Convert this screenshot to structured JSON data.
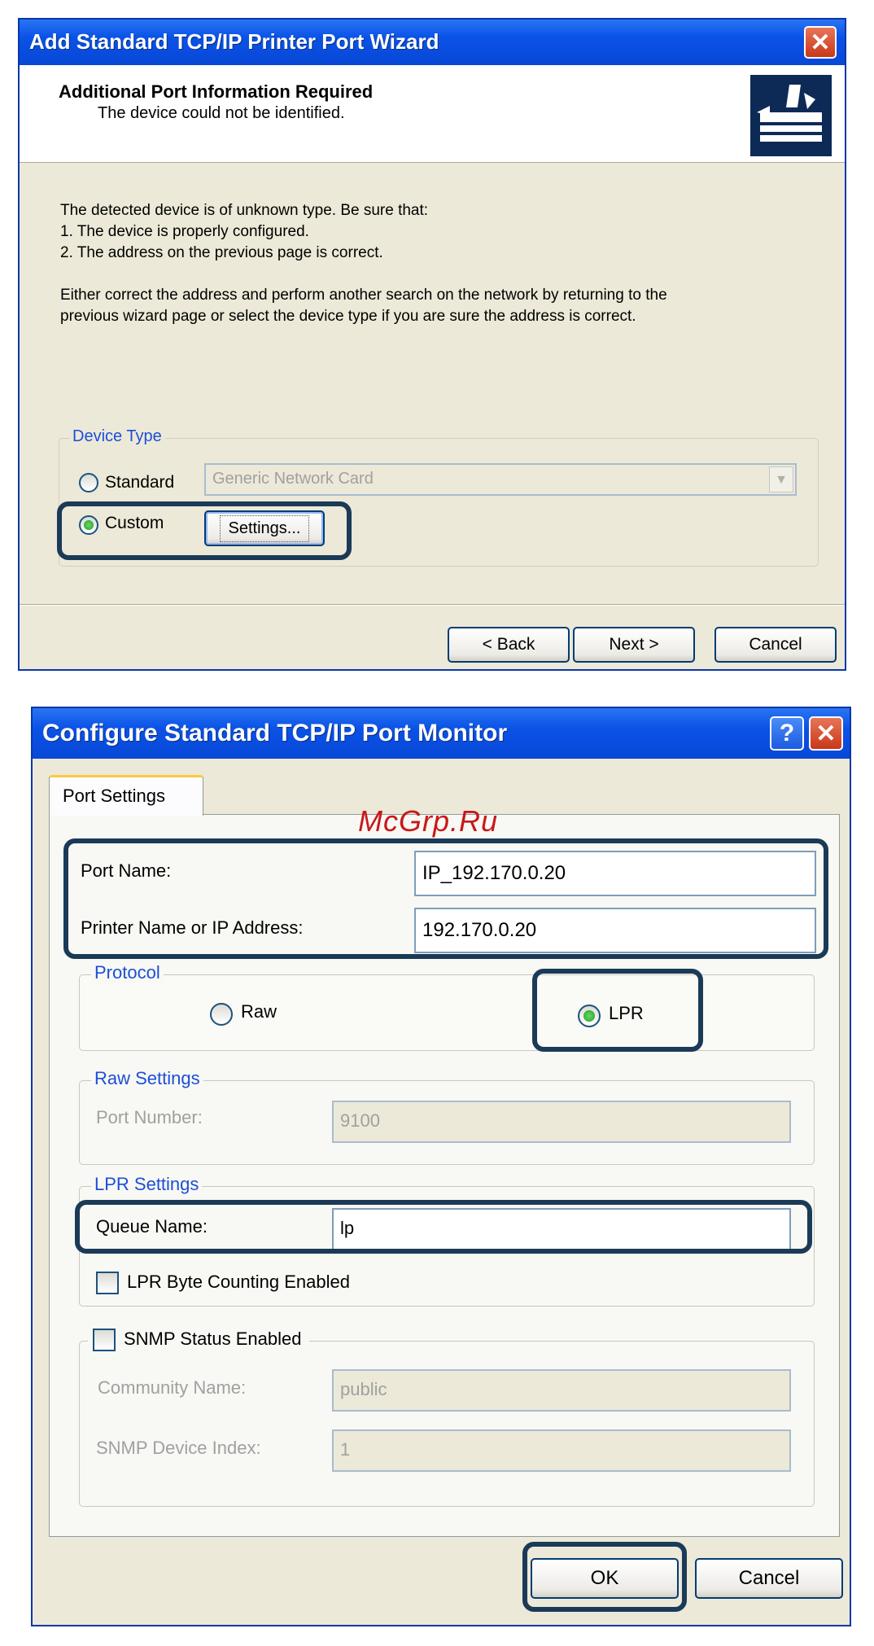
{
  "wizard": {
    "title": "Add Standard TCP/IP Printer Port Wizard",
    "close_icon": "close-icon",
    "header_title": "Additional Port Information Required",
    "header_subtitle": "The device could not be identified.",
    "header_icon": "printer-network-icon",
    "body_line1": "The detected device is of unknown type.  Be sure that:",
    "body_line2": "1. The device is properly configured.",
    "body_line3": "2.  The address on the previous page is correct.",
    "body_para_line1": "Either correct the address and perform another search on the network by returning to the",
    "body_para_line2": "previous wizard page or select the device type if you are sure the address is correct.",
    "device_type_legend": "Device Type",
    "standard_label": "Standard",
    "standard_selected": false,
    "standard_dropdown_value": "Generic Network Card",
    "custom_label": "Custom",
    "custom_selected": true,
    "settings_button": "Settings...",
    "back_button": "< Back",
    "next_button": "Next >",
    "cancel_button": "Cancel"
  },
  "monitor": {
    "title": "Configure Standard TCP/IP Port Monitor",
    "help_icon": "help-icon",
    "close_icon": "close-icon",
    "tab_label": "Port Settings",
    "port_name_label": "Port Name:",
    "port_name_value": "IP_192.170.0.20",
    "printer_name_label": "Printer Name or IP Address:",
    "printer_name_value": "192.170.0.20",
    "protocol_legend": "Protocol",
    "raw_label": "Raw",
    "raw_selected": false,
    "lpr_label": "LPR",
    "lpr_selected": true,
    "raw_settings_legend": "Raw Settings",
    "port_number_label": "Port Number:",
    "port_number_value": "9100",
    "lpr_settings_legend": "LPR Settings",
    "queue_name_label": "Queue Name:",
    "queue_name_value": "lp",
    "byte_counting_label": "LPR Byte Counting Enabled",
    "byte_counting_checked": false,
    "snmp_label": "SNMP Status Enabled",
    "snmp_checked": false,
    "community_label": "Community Name:",
    "community_value": "public",
    "device_index_label": "SNMP Device Index:",
    "device_index_value": "1",
    "ok_button": "OK",
    "cancel_button": "Cancel"
  },
  "watermark": "McGrp.Ru"
}
